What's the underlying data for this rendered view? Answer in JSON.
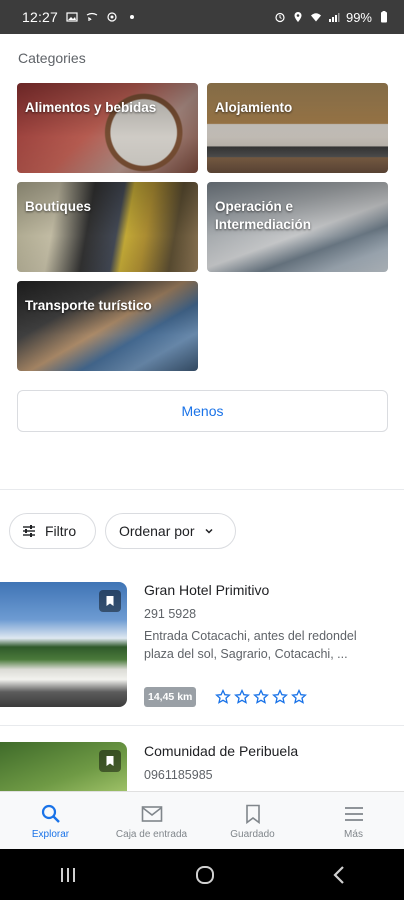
{
  "status_bar": {
    "time": "12:27",
    "battery": "99%"
  },
  "categories": {
    "title": "Categories",
    "items": [
      {
        "label": "Alimentos y bebidas"
      },
      {
        "label": "Alojamiento"
      },
      {
        "label": "Boutiques"
      },
      {
        "label": "Operación e Intermediación"
      },
      {
        "label": "Transporte turístico"
      }
    ],
    "less_button": "Menos"
  },
  "filters": {
    "filter_label": "Filtro",
    "sort_label": "Ordenar por"
  },
  "results": [
    {
      "name": "Gran Hotel Primitivo",
      "phone": "291 5928",
      "address": "Entrada Cotacachi, antes del redondel plaza del sol, Sagrario, Cotacachi, ...",
      "distance": "14,45 km",
      "rating": 0
    },
    {
      "name": "Comunidad de Peribuela",
      "phone": "0961185985"
    }
  ],
  "bottom_nav": [
    {
      "label": "Explorar",
      "icon": "search-icon",
      "active": true
    },
    {
      "label": "Caja de entrada",
      "icon": "mail-icon",
      "active": false
    },
    {
      "label": "Guardado",
      "icon": "bookmark-icon",
      "active": false
    },
    {
      "label": "Más",
      "icon": "menu-icon",
      "active": false
    }
  ],
  "colors": {
    "accent": "#1a73e8",
    "star": "#1a73e8",
    "status_bar": "#3c3c3c"
  }
}
